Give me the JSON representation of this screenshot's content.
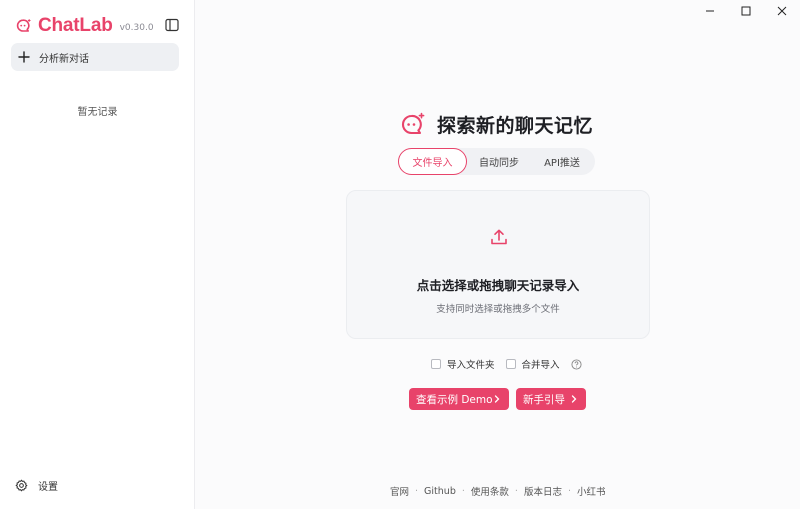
{
  "app": {
    "name": "ChatLab",
    "version": "v0.30.0",
    "brand_color": "#e8436a"
  },
  "sidebar": {
    "new_chat_label": "分析新对话",
    "empty_text": "暂无记录",
    "settings_label": "设置"
  },
  "main": {
    "title": "探索新的聊天记忆",
    "tabs": [
      {
        "label": "文件导入",
        "active": true
      },
      {
        "label": "自动同步",
        "active": false
      },
      {
        "label": "API推送",
        "active": false
      }
    ],
    "dropzone": {
      "title": "点击选择或拖拽聊天记录导入",
      "subtitle": "支持同时选择或拖拽多个文件"
    },
    "options": [
      {
        "label": "导入文件夹",
        "checked": false
      },
      {
        "label": "合并导入",
        "checked": false
      }
    ],
    "buttons": {
      "demo": "查看示例 Demo",
      "guide": "新手引导"
    }
  },
  "footer": {
    "links": [
      "官网",
      "Github",
      "使用条款",
      "版本日志",
      "小红书"
    ]
  }
}
